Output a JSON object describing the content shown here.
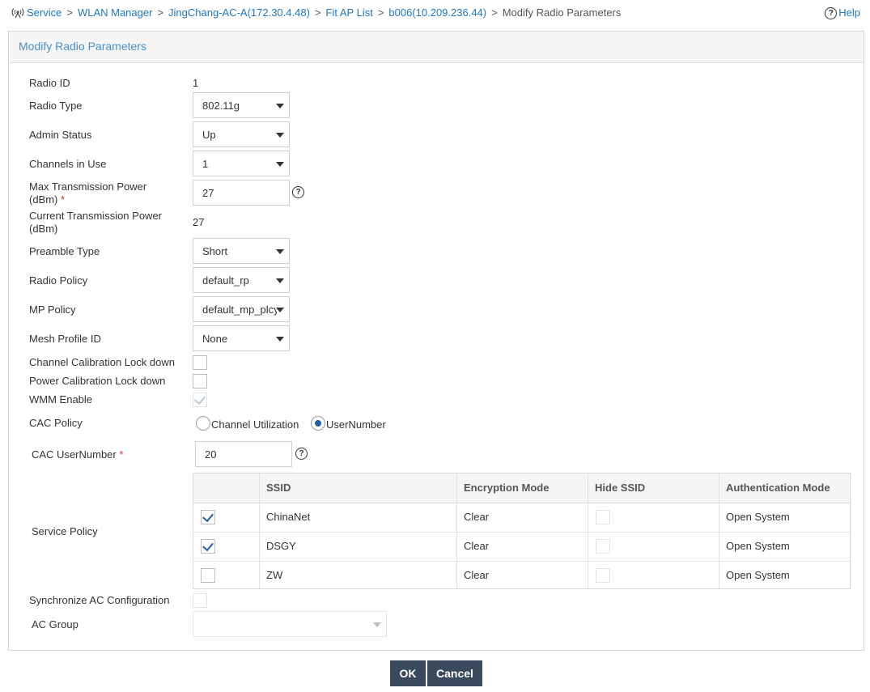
{
  "breadcrumb": {
    "items": [
      "Service",
      "WLAN Manager",
      "JingChang-AC-A(172.30.4.48)",
      "Fit AP List",
      "b006(10.209.236.44)"
    ],
    "current": "Modify Radio Parameters",
    "separator": ">"
  },
  "help_label": "Help",
  "help_glyph": "?",
  "panel_title": "Modify Radio Parameters",
  "form": {
    "radio_id_label": "Radio ID",
    "radio_id_value": "1",
    "radio_type_label": "Radio Type",
    "radio_type_value": "802.11g",
    "admin_status_label": "Admin Status",
    "admin_status_value": "Up",
    "channels_label": "Channels in Use",
    "channels_value": "1",
    "max_power_label_1": "Max Transmission Power",
    "max_power_label_2": "(dBm)",
    "max_power_value": "27",
    "required_mark": "*",
    "cur_power_label_1": "Current Transmission Power",
    "cur_power_label_2": "(dBm)",
    "cur_power_value": "27",
    "preamble_label": "Preamble Type",
    "preamble_value": "Short",
    "radio_policy_label": "Radio Policy",
    "radio_policy_value": "default_rp",
    "mp_policy_label": "MP Policy",
    "mp_policy_value": "default_mp_plcy",
    "mesh_profile_label": "Mesh Profile ID",
    "mesh_profile_value": "None",
    "channel_cal_label": "Channel Calibration Lock down",
    "channel_cal_checked": false,
    "power_cal_label": "Power Calibration Lock down",
    "power_cal_checked": false,
    "wmm_label": "WMM Enable",
    "wmm_checked": true,
    "cac_policy_label": "CAC Policy",
    "cac_options": [
      "Channel Utilization",
      "UserNumber"
    ],
    "cac_selected": "UserNumber",
    "cac_usernumber_label": "CAC UserNumber",
    "cac_usernumber_value": "20",
    "service_policy_label": "Service Policy",
    "sync_label": "Synchronize AC Configuration",
    "sync_checked": false,
    "ac_group_label": "AC Group",
    "ac_group_value": ""
  },
  "service_table": {
    "columns": [
      "",
      "SSID",
      "Encryption Mode",
      "Hide SSID",
      "Authentication Mode"
    ],
    "rows": [
      {
        "selected": true,
        "ssid": "ChinaNet",
        "encryption": "Clear",
        "hide": false,
        "auth": "Open System"
      },
      {
        "selected": true,
        "ssid": "DSGY",
        "encryption": "Clear",
        "hide": false,
        "auth": "Open System"
      },
      {
        "selected": false,
        "ssid": "ZW",
        "encryption": "Clear",
        "hide": false,
        "auth": "Open System"
      }
    ]
  },
  "buttons": {
    "ok": "OK",
    "cancel": "Cancel"
  },
  "colors": {
    "link": "#1e78c2",
    "title": "#4a90c8",
    "button_bg": "#3a4a5c",
    "required": "#d9302c",
    "check": "#1f5fa8"
  }
}
